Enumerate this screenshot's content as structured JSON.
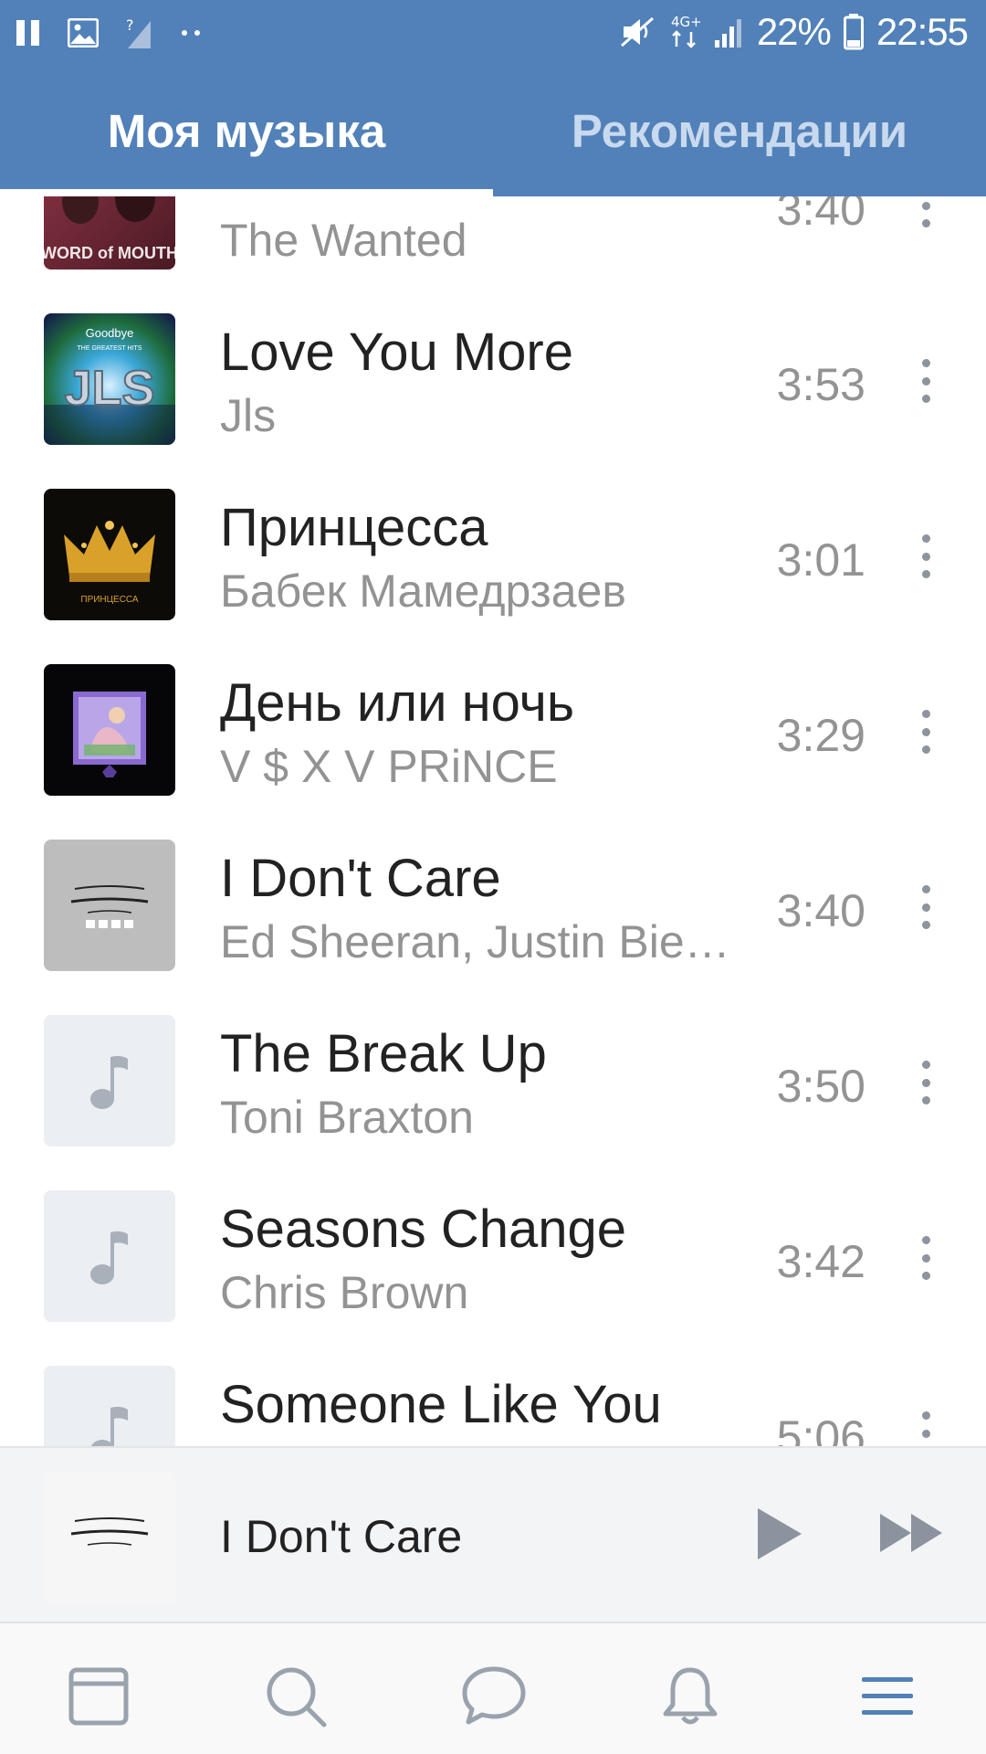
{
  "status_bar": {
    "battery": "22%",
    "time": "22:55",
    "network": "4G+"
  },
  "tabs": [
    {
      "label": "Моя музыка",
      "active": true
    },
    {
      "label": "Рекомендации",
      "active": false
    }
  ],
  "tracks": [
    {
      "title": "",
      "artist": "The Wanted",
      "duration": "3:40",
      "cover": "word-of-mouth-art"
    },
    {
      "title": "Love You More",
      "artist": "Jls",
      "duration": "3:53",
      "cover": "jls-goodbye-art"
    },
    {
      "title": "Принцесса",
      "artist": "Бабек Мамедрзаев",
      "duration": "3:01",
      "cover": "crown-art"
    },
    {
      "title": "День или ночь",
      "artist": "V $ X V PRiNCE",
      "duration": "3:29",
      "cover": "purple-illustration-art"
    },
    {
      "title": "I Don't Care",
      "artist": "Ed Sheeran, Justin Bie…",
      "duration": "3:40",
      "cover": "i-dont-care-art"
    },
    {
      "title": "The Break Up",
      "artist": "Toni Braxton",
      "duration": "3:50",
      "cover": "music-note-icon"
    },
    {
      "title": "Seasons Change",
      "artist": "Chris Brown",
      "duration": "3:42",
      "cover": "music-note-icon"
    },
    {
      "title": "Someone Like You",
      "artist": "",
      "duration": "5:06",
      "cover": "music-note-icon"
    }
  ],
  "player": {
    "title": "I Don't Care",
    "cover": "i-dont-care-art"
  },
  "bottom_nav": [
    "news-icon",
    "search-icon",
    "messages-icon",
    "notifications-icon",
    "menu-icon"
  ],
  "colors": {
    "header": "#5181b8",
    "accent": "#5181b8",
    "secondary_text": "#939393"
  }
}
